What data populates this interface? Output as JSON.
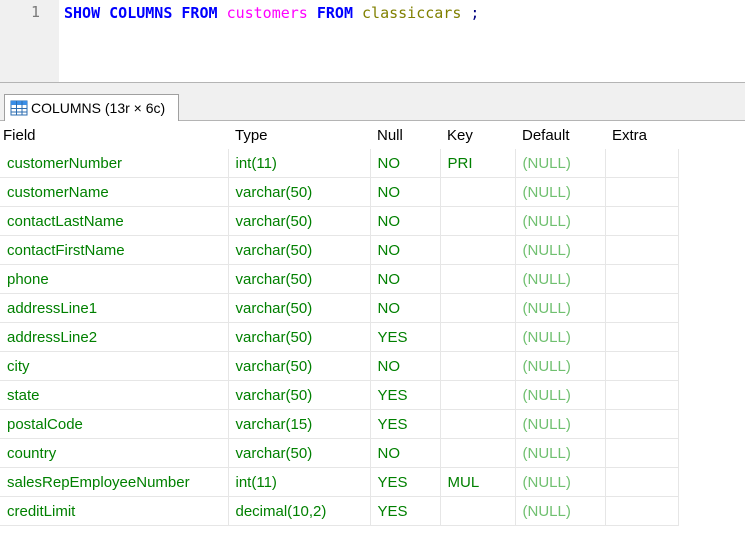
{
  "editor": {
    "line_number": "1",
    "tokens": {
      "show": "SHOW",
      "columns": "COLUMNS",
      "from1": "FROM",
      "table": "customers",
      "from2": "FROM",
      "database": "classiccars",
      "semicolon": ";"
    },
    "colors": {
      "keyword": "#0000ff",
      "identifier": "#ff00ff",
      "database": "#808000"
    }
  },
  "result_tab": {
    "label": "COLUMNS (13r × 6c)",
    "icon": "table-grid-icon"
  },
  "grid": {
    "headers": [
      "Field",
      "Type",
      "Null",
      "Key",
      "Default",
      "Extra"
    ],
    "rows": [
      [
        "customerNumber",
        "int(11)",
        "NO",
        "PRI",
        "(NULL)",
        ""
      ],
      [
        "customerName",
        "varchar(50)",
        "NO",
        "",
        "(NULL)",
        ""
      ],
      [
        "contactLastName",
        "varchar(50)",
        "NO",
        "",
        "(NULL)",
        ""
      ],
      [
        "contactFirstName",
        "varchar(50)",
        "NO",
        "",
        "(NULL)",
        ""
      ],
      [
        "phone",
        "varchar(50)",
        "NO",
        "",
        "(NULL)",
        ""
      ],
      [
        "addressLine1",
        "varchar(50)",
        "NO",
        "",
        "(NULL)",
        ""
      ],
      [
        "addressLine2",
        "varchar(50)",
        "YES",
        "",
        "(NULL)",
        ""
      ],
      [
        "city",
        "varchar(50)",
        "NO",
        "",
        "(NULL)",
        ""
      ],
      [
        "state",
        "varchar(50)",
        "YES",
        "",
        "(NULL)",
        ""
      ],
      [
        "postalCode",
        "varchar(15)",
        "YES",
        "",
        "(NULL)",
        ""
      ],
      [
        "country",
        "varchar(50)",
        "NO",
        "",
        "(NULL)",
        ""
      ],
      [
        "salesRepEmployeeNumber",
        "int(11)",
        "YES",
        "MUL",
        "(NULL)",
        ""
      ],
      [
        "creditLimit",
        "decimal(10,2)",
        "YES",
        "",
        "(NULL)",
        ""
      ]
    ],
    "colors": {
      "cell_text": "#008000",
      "null_text": "#70c070"
    }
  }
}
